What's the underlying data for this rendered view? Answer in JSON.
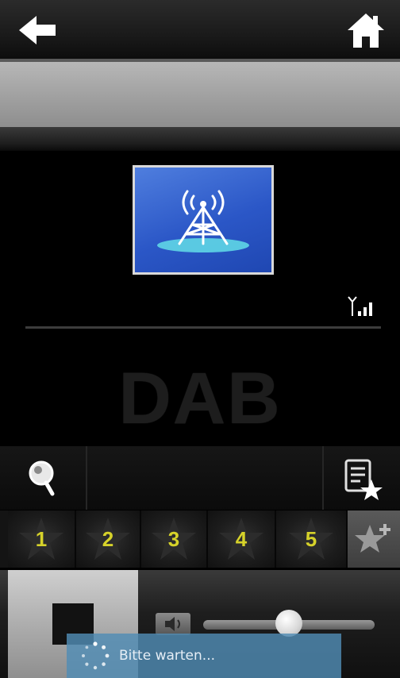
{
  "header": {
    "back_icon": "arrow-left-icon",
    "home_icon": "home-icon"
  },
  "station": {
    "logo_icon": "radio-tower-icon",
    "signal_icon": "signal-strength-icon",
    "source_label": "DAB"
  },
  "controls": {
    "search_icon": "search-icon",
    "favorites_list_icon": "favorites-list-icon"
  },
  "presets": {
    "items": [
      {
        "label": "1"
      },
      {
        "label": "2"
      },
      {
        "label": "3"
      },
      {
        "label": "4"
      },
      {
        "label": "5"
      }
    ],
    "add_favorite_icon": "add-favorite-star-icon",
    "number_color": "#d6d22a"
  },
  "playback": {
    "stop_icon": "stop-icon",
    "speaker_icon": "speaker-icon",
    "volume_level": 0.42
  },
  "toast": {
    "message": "Bitte warten..."
  },
  "colors": {
    "logo_blue": "#2b57c7",
    "toast_blue": "#508cb4"
  }
}
